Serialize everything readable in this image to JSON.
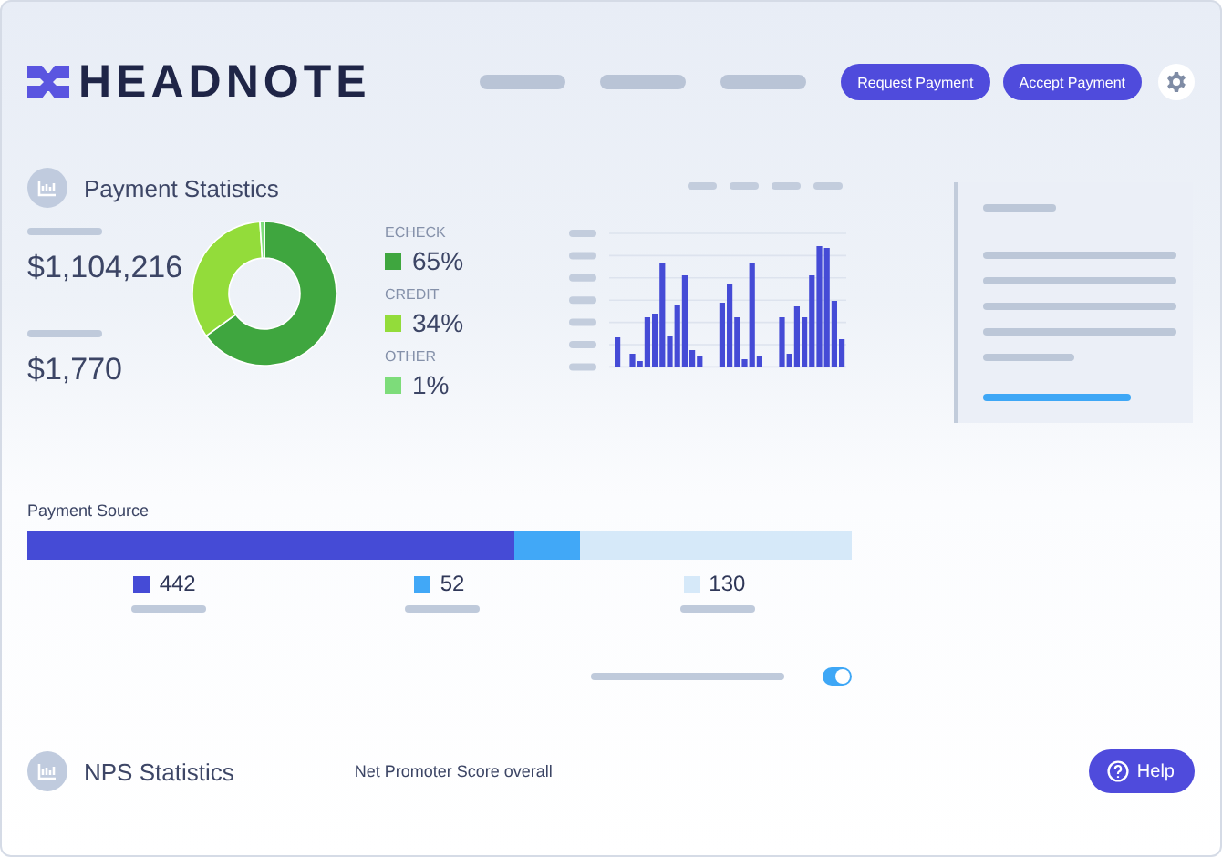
{
  "header": {
    "logo": "HEADNOTE",
    "buttons": [
      "Request Payment",
      "Accept Payment"
    ]
  },
  "payment_statistics": {
    "title": "Payment Statistics",
    "totals": [
      "$1,104,216",
      "$1,770"
    ],
    "legend": [
      {
        "value": "65%",
        "color": "#3fa63f"
      },
      {
        "value": "34%",
        "color": "#93dc3a"
      },
      {
        "value": "1%",
        "color": "#7ddc7a"
      }
    ],
    "chart_data": {
      "type": "donut",
      "categories": [
        "ECHECK",
        "CREDIT",
        "OTHER"
      ],
      "series": [
        {
          "values": [
            65,
            34,
            1
          ]
        }
      ]
    }
  },
  "payment_source": {
    "title": "Payment Source",
    "segments": [
      {
        "value": "442",
        "color": "#454bd6"
      },
      {
        "value": "52",
        "color": "#41a8f7"
      },
      {
        "value": "130",
        "color": "#d6e9f9"
      }
    ]
  },
  "toggle": {
    "on": true
  },
  "nps": {
    "title": "NPS Statistics",
    "caption": "Net Promoter Score overall"
  },
  "help_button": "Help"
}
